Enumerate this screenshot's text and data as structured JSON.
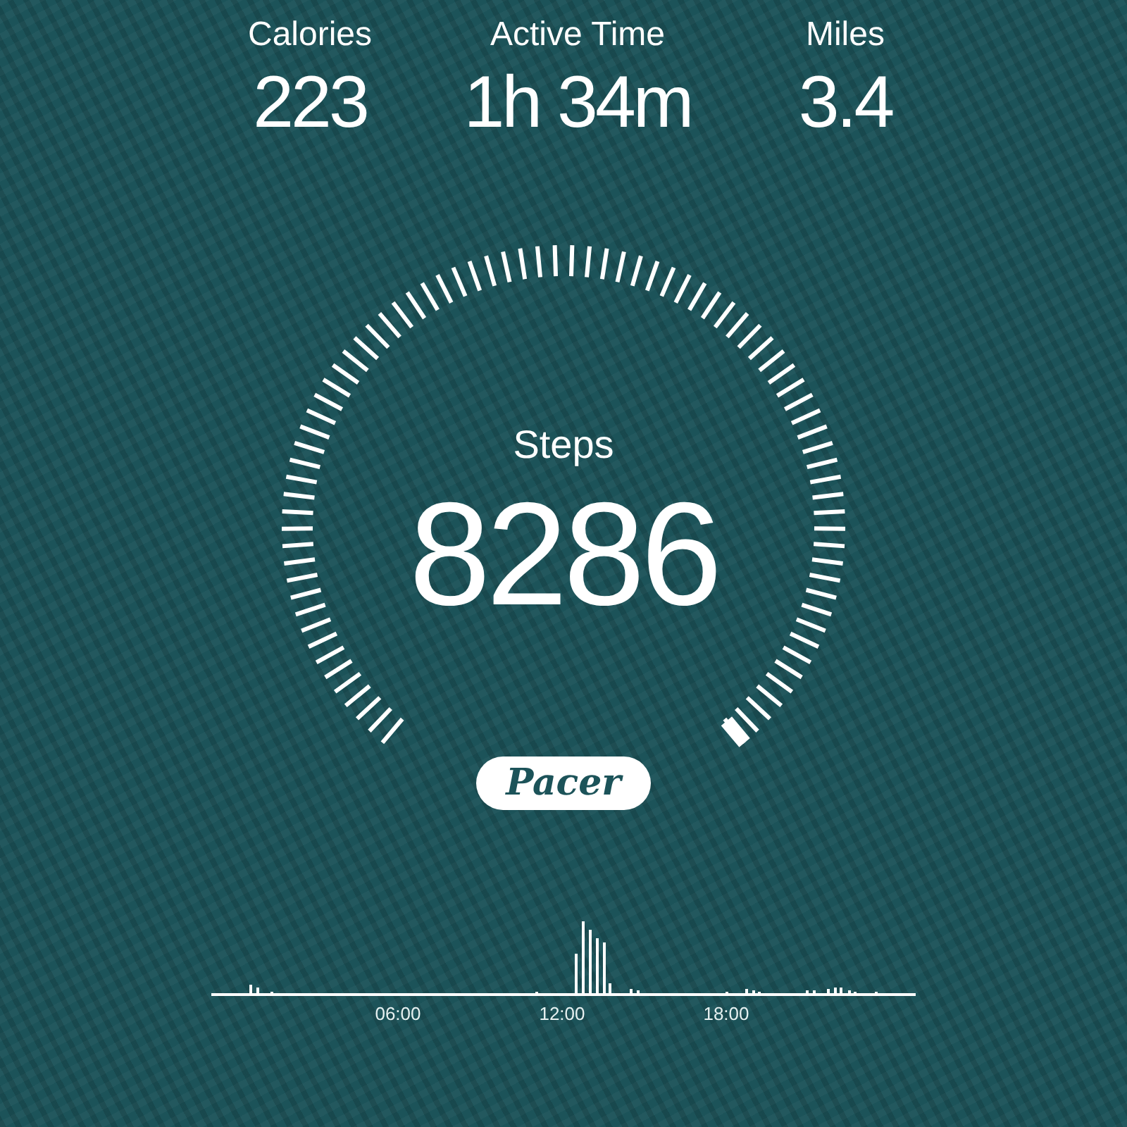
{
  "stats": [
    {
      "label": "Calories",
      "value": "223"
    },
    {
      "label": "Active Time",
      "value": "1h 34m"
    },
    {
      "label": "Miles",
      "value": "3.4"
    }
  ],
  "steps": {
    "label": "Steps",
    "value": "8286"
  },
  "logo": "Pacer",
  "activity": {
    "time_labels": [
      "06:00",
      "12:00",
      "18:00"
    ]
  }
}
